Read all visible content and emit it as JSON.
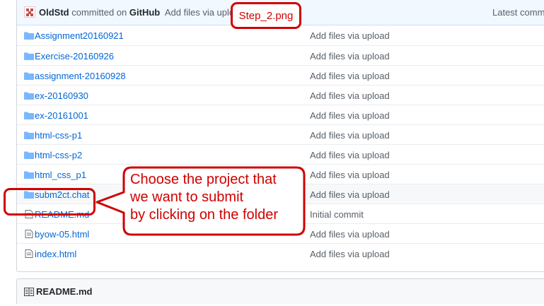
{
  "commit": {
    "author": "OldStd",
    "action": "committed on",
    "platform": "GitHub",
    "message": "Add files via upload",
    "latest": "Latest commit"
  },
  "files": [
    {
      "name": "Assignment20160921",
      "type": "folder",
      "message": "Add files via upload"
    },
    {
      "name": "Exercise-20160926",
      "type": "folder",
      "message": "Add files via upload"
    },
    {
      "name": "assignment-20160928",
      "type": "folder",
      "message": "Add files via upload"
    },
    {
      "name": "ex-20160930",
      "type": "folder",
      "message": "Add files via upload"
    },
    {
      "name": "ex-20161001",
      "type": "folder",
      "message": "Add files via upload"
    },
    {
      "name": "html-css-p1",
      "type": "folder",
      "message": "Add files via upload"
    },
    {
      "name": "html-css-p2",
      "type": "folder",
      "message": "Add files via upload"
    },
    {
      "name": "html_css_p1",
      "type": "folder",
      "message": "Add files via upload"
    },
    {
      "name": "subm2ct.chat",
      "type": "folder",
      "message": "Add files via upload"
    },
    {
      "name": "README.md",
      "type": "file",
      "message": "Initial commit"
    },
    {
      "name": "byow-05.html",
      "type": "file",
      "message": "Add files via upload"
    },
    {
      "name": "index.html",
      "type": "file",
      "message": "Add files via upload"
    }
  ],
  "readme": {
    "title": "README.md"
  },
  "annotation": {
    "step_label": "Step_2.png",
    "callout_lines": [
      "Choose the project that",
      "we want to submit",
      "by clicking on the folder"
    ]
  },
  "colors": {
    "accent_red": "#d00000",
    "link_blue": "#0366d6",
    "folder_icon": "#79b8ff"
  }
}
